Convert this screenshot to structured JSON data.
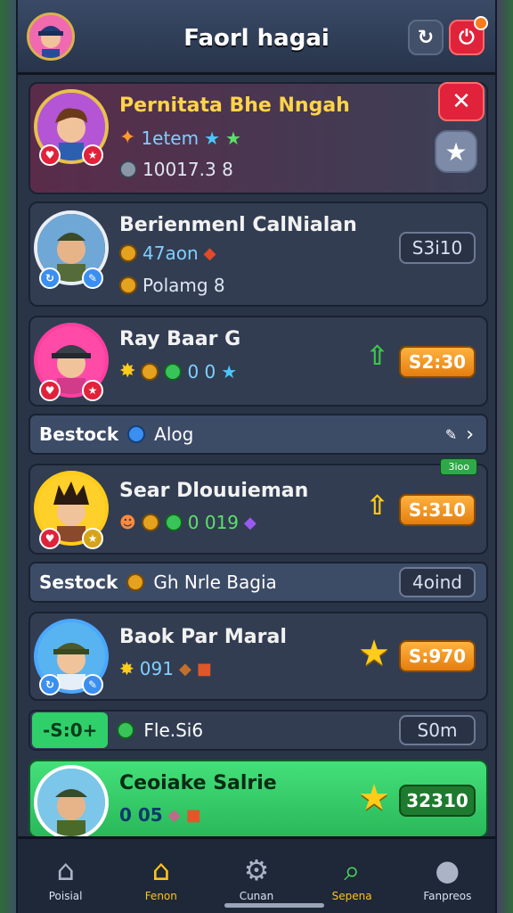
{
  "header": {
    "title": "Faorl hagai",
    "refresh_icon": "refresh-icon",
    "power_icon": "power-icon"
  },
  "rows": [
    {
      "name": "Pernitata Bhe Nngah",
      "line1": "1etem",
      "line2": "10017.3 8"
    },
    {
      "name": "Berienmenl CalNialan",
      "line1": "47aon",
      "line2": "Polamg 8",
      "price": "S3i10"
    },
    {
      "name": "Ray Baar G",
      "line1": "0 0",
      "price": "S2:30"
    },
    {
      "name": "Sear Dlouuieman",
      "line1": "0 019",
      "price": "S:310"
    },
    {
      "name": "Baok Par Maral",
      "line1": "091",
      "price": "S:970"
    },
    {
      "name": "Ceoiake Salrie",
      "line1": "0 05",
      "price": "32310"
    }
  ],
  "sections": [
    {
      "label": "Bestock",
      "text": "Alog"
    },
    {
      "label": "Sestock",
      "text": "Gh Nrle Bagia",
      "button": "4oind"
    },
    {
      "label": "-S:0+",
      "text": "Fle.Si6",
      "button": "S0m"
    }
  ],
  "tag_green": "3ioo",
  "nav": [
    {
      "label": "Poisial",
      "icon": "home-icon"
    },
    {
      "label": "Fenon",
      "icon": "home-gold-icon"
    },
    {
      "label": "Cunan",
      "icon": "gear-icon"
    },
    {
      "label": "Sepena",
      "icon": "search-icon"
    },
    {
      "label": "Fanpreos",
      "icon": "profile-icon"
    }
  ]
}
